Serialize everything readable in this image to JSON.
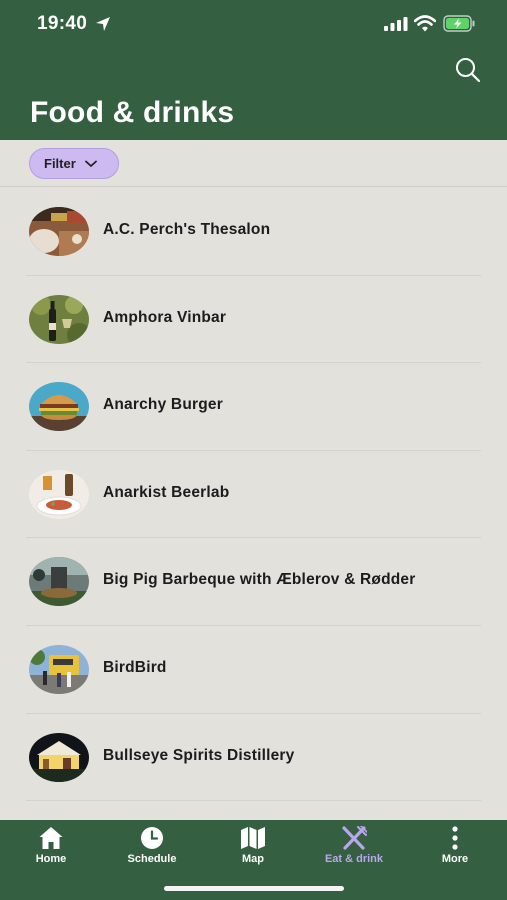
{
  "status_bar": {
    "time": "19:40"
  },
  "header": {
    "title": "Food & drinks"
  },
  "filter": {
    "label": "Filter"
  },
  "venues": [
    {
      "name": "A.C. Perch's Thesalon",
      "image": "tea-salon-photo"
    },
    {
      "name": "Amphora Vinbar",
      "image": "wine-bottle-photo"
    },
    {
      "name": "Anarchy Burger",
      "image": "burger-photo"
    },
    {
      "name": "Anarkist Beerlab",
      "image": "beer-and-food-photo"
    },
    {
      "name": "Big Pig Barbeque with Æblerov & Rødder",
      "image": "barbeque-grill-photo"
    },
    {
      "name": "BirdBird",
      "image": "food-truck-photo"
    },
    {
      "name": "Bullseye Spirits Distillery",
      "image": "night-tent-photo"
    }
  ],
  "tabs": [
    {
      "label": "Home",
      "icon": "home-icon"
    },
    {
      "label": "Schedule",
      "icon": "clock-icon"
    },
    {
      "label": "Map",
      "icon": "map-icon"
    },
    {
      "label": "Eat & drink",
      "icon": "fork-knife-icon",
      "active": true
    },
    {
      "label": "More",
      "icon": "more-dots-icon"
    }
  ],
  "colors": {
    "brand_green": "#345f40",
    "background": "#e2e1dc",
    "filter_chip": "#cdbaf1",
    "active_tab": "#b9a7ec"
  }
}
